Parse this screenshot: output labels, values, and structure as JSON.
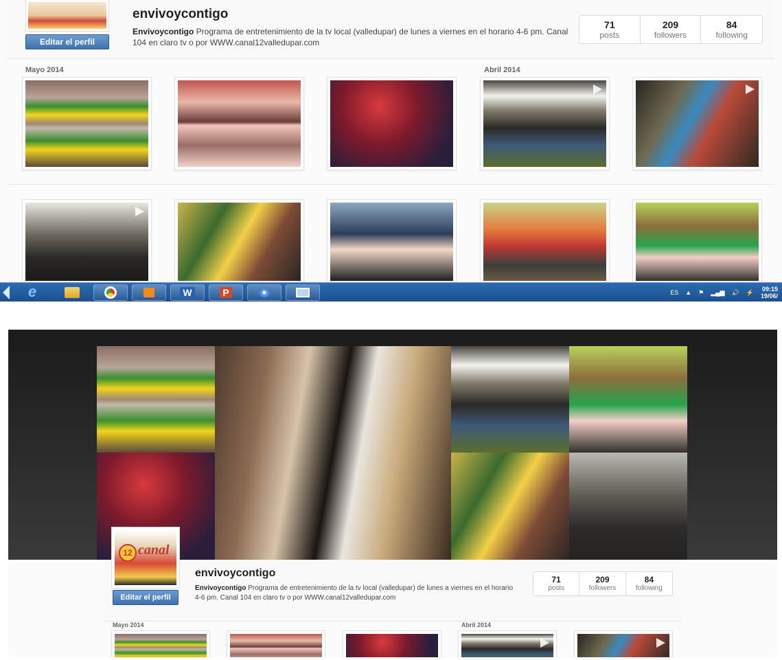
{
  "profile": {
    "username": "envivoycontigo",
    "bio_name": "Envivoycontigo",
    "bio_text": " Programa de entretenimiento de la tv local (valledupar) de lunes a viernes en el horario 4-6 pm. Canal 104 en claro tv o por WWW.canal12valledupar.com",
    "edit_button": "Editar el perfil",
    "avatar_brand": "canal",
    "avatar_badge": "12",
    "stats": [
      {
        "num": "71",
        "label": "posts"
      },
      {
        "num": "209",
        "label": "followers"
      },
      {
        "num": "84",
        "label": "following"
      }
    ]
  },
  "months": {
    "may": "Mayo 2014",
    "april": "Abril 2014"
  },
  "taskbar": {
    "lang": "ES",
    "time": "09:15",
    "date": "19/06/",
    "apps": [
      "ie-icon",
      "explorer-icon",
      "chrome-icon",
      "media-icon",
      "word-icon",
      "powerpoint-icon",
      "paint-icon",
      "window-icon"
    ],
    "word_label": "W",
    "ppt_label": "P"
  }
}
